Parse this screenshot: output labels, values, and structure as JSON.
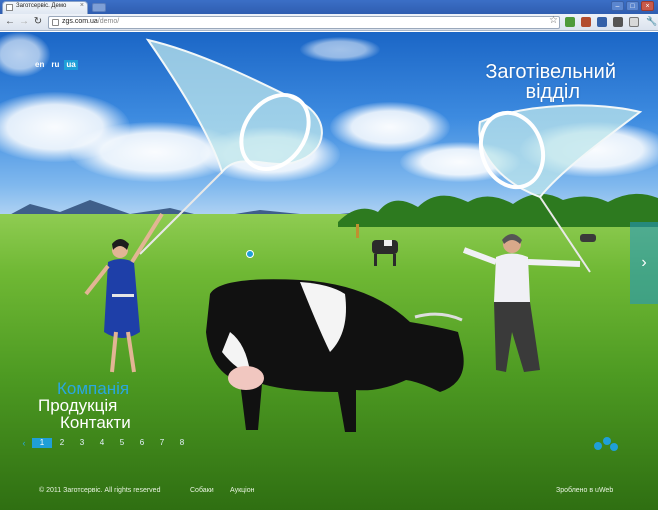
{
  "browser": {
    "tab_title": "Заготсервіс. Демо",
    "url_host": "zgs.com.ua",
    "url_path": "/demo/"
  },
  "site": {
    "languages": [
      "en",
      "ru",
      "ua"
    ],
    "active_language": "ua",
    "title_line1": "Заготівельний",
    "title_line2": "відділ",
    "menu": [
      "Компанія",
      "Продукція",
      "Контакти"
    ],
    "pages": [
      "1",
      "2",
      "3",
      "4",
      "5",
      "6",
      "7",
      "8"
    ],
    "active_page": "1",
    "footer": {
      "copyright": "© 2011 Заготсервіс. All rights reserved",
      "links": [
        "Собаки",
        "Аукціон"
      ],
      "made_by": "Зроблено в uWeb"
    }
  },
  "icons": {
    "back": "back-arrow-icon",
    "forward": "forward-arrow-icon",
    "reload": "reload-icon",
    "star": "bookmark-star-icon",
    "wrench": "wrench-icon"
  }
}
